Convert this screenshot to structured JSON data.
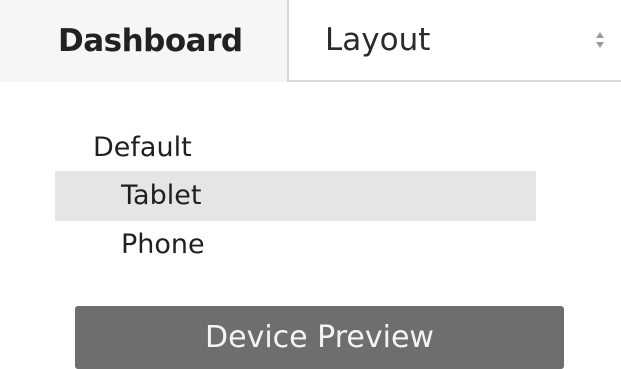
{
  "tabs": {
    "dashboard_label": "Dashboard",
    "layout_label": "Layout",
    "layout_control_icon": "up-down-stepper-icon"
  },
  "device_list": {
    "items": [
      {
        "label": "Default",
        "level": 0,
        "selected": false
      },
      {
        "label": "Tablet",
        "level": 1,
        "selected": true
      },
      {
        "label": "Phone",
        "level": 1,
        "selected": false
      }
    ]
  },
  "preview_button": {
    "label": "Device Preview"
  },
  "colors": {
    "selected_row": "#e5e5e5",
    "button_bg": "#6e6e6e",
    "button_text": "#f4f4f4",
    "inactive_tab_bg": "#f6f6f6",
    "divider": "#d9d9d9"
  }
}
